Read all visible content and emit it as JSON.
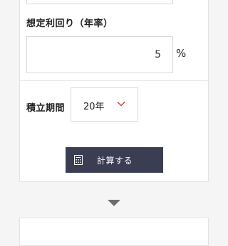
{
  "form": {
    "rate_label": "想定利回り（年率）",
    "rate_value": "5",
    "rate_unit": "%",
    "term_label": "積立期間",
    "term_value": "20年",
    "calc_button_label": "計算する"
  },
  "icons": {
    "chevron": "chevron-down-icon",
    "calculator": "calculator-icon",
    "result_arrow": "arrow-down-icon"
  },
  "colors": {
    "button_bg": "#3b3d53",
    "chevron": "#c0392b",
    "arrow": "#6e6e6e"
  }
}
